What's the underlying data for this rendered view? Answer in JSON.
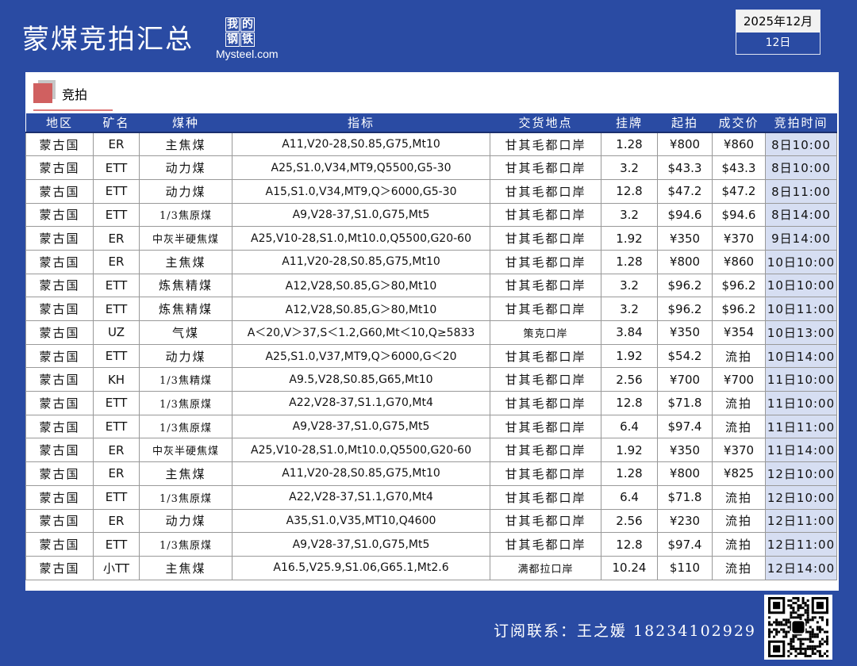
{
  "header": {
    "title": "蒙煤竞拍汇总",
    "logo_text": "我的钢铁 Mysteel.com",
    "logo_cn": [
      "我",
      "的",
      "钢",
      "铁"
    ],
    "logo_en": "Mysteel.com",
    "month": "2025年12月",
    "day": "12日"
  },
  "section": {
    "label": "竞拍"
  },
  "table": {
    "columns": [
      "地区",
      "矿名",
      "煤种",
      "指标",
      "交货地点",
      "挂牌",
      "起拍",
      "成交价",
      "竞拍时间"
    ],
    "rows": [
      [
        "蒙古国",
        "ER",
        "主焦煤",
        "A11,V20-28,S0.85,G75,Mt10",
        "甘其毛都口岸",
        "1.28",
        "¥800",
        "¥860",
        "8日10:00"
      ],
      [
        "蒙古国",
        "ETT",
        "动力煤",
        "A25,S1.0,V34,MT9,Q5500,G5-30",
        "甘其毛都口岸",
        "3.2",
        "$43.3",
        "$43.3",
        "8日10:00"
      ],
      [
        "蒙古国",
        "ETT",
        "动力煤",
        "A15,S1.0,V34,MT9,Q＞6000,G5-30",
        "甘其毛都口岸",
        "12.8",
        "$47.2",
        "$47.2",
        "8日11:00"
      ],
      [
        "蒙古国",
        "ETT",
        "1/3焦原煤",
        "A9,V28-37,S1.0,G75,Mt5",
        "甘其毛都口岸",
        "3.2",
        "$94.6",
        "$94.6",
        "8日14:00"
      ],
      [
        "蒙古国",
        "ER",
        "中灰半硬焦煤",
        "A25,V10-28,S1.0,Mt10.0,Q5500,G20-60",
        "甘其毛都口岸",
        "1.92",
        "¥350",
        "¥370",
        "9日14:00"
      ],
      [
        "蒙古国",
        "ER",
        "主焦煤",
        "A11,V20-28,S0.85,G75,Mt10",
        "甘其毛都口岸",
        "1.28",
        "¥800",
        "¥860",
        "10日10:00"
      ],
      [
        "蒙古国",
        "ETT",
        "炼焦精煤",
        "A12,V28,S0.85,G＞80,Mt10",
        "甘其毛都口岸",
        "3.2",
        "$96.2",
        "$96.2",
        "10日10:00"
      ],
      [
        "蒙古国",
        "ETT",
        "炼焦精煤",
        "A12,V28,S0.85,G＞80,Mt10",
        "甘其毛都口岸",
        "3.2",
        "$96.2",
        "$96.2",
        "10日11:00"
      ],
      [
        "蒙古国",
        "UZ",
        "气煤",
        "A＜20,V＞37,S＜1.2,G60,Mt＜10,Q≥5833",
        "策克口岸",
        "3.84",
        "¥350",
        "¥354",
        "10日13:00"
      ],
      [
        "蒙古国",
        "ETT",
        "动力煤",
        "A25,S1.0,V37,MT9,Q＞6000,G＜20",
        "甘其毛都口岸",
        "1.92",
        "$54.2",
        "流拍",
        "10日14:00"
      ],
      [
        "蒙古国",
        "KH",
        "1/3焦精煤",
        "A9.5,V28,S0.85,G65,Mt10",
        "甘其毛都口岸",
        "2.56",
        "¥700",
        "¥700",
        "11日10:00"
      ],
      [
        "蒙古国",
        "ETT",
        "1/3焦原煤",
        "A22,V28-37,S1.1,G70,Mt4",
        "甘其毛都口岸",
        "12.8",
        "$71.8",
        "流拍",
        "11日10:00"
      ],
      [
        "蒙古国",
        "ETT",
        "1/3焦原煤",
        "A9,V28-37,S1.0,G75,Mt5",
        "甘其毛都口岸",
        "6.4",
        "$97.4",
        "流拍",
        "11日11:00"
      ],
      [
        "蒙古国",
        "ER",
        "中灰半硬焦煤",
        "A25,V10-28,S1.0,Mt10.0,Q5500,G20-60",
        "甘其毛都口岸",
        "1.92",
        "¥350",
        "¥370",
        "11日14:00"
      ],
      [
        "蒙古国",
        "ER",
        "主焦煤",
        "A11,V20-28,S0.85,G75,Mt10",
        "甘其毛都口岸",
        "1.28",
        "¥800",
        "¥825",
        "12日10:00"
      ],
      [
        "蒙古国",
        "ETT",
        "1/3焦原煤",
        "A22,V28-37,S1.1,G70,Mt4",
        "甘其毛都口岸",
        "6.4",
        "$71.8",
        "流拍",
        "12日10:00"
      ],
      [
        "蒙古国",
        "ER",
        "动力煤",
        "A35,S1.0,V35,MT10,Q4600",
        "甘其毛都口岸",
        "2.56",
        "¥230",
        "流拍",
        "12日11:00"
      ],
      [
        "蒙古国",
        "ETT",
        "1/3焦原煤",
        "A9,V28-37,S1.0,G75,Mt5",
        "甘其毛都口岸",
        "12.8",
        "$97.4",
        "流拍",
        "12日11:00"
      ],
      [
        "蒙古国",
        "小TT",
        "主焦煤",
        "A16.5,V25.9,S1.06,G65.1,Mt2.6",
        "满都拉口岸",
        "10.24",
        "$110",
        "流拍",
        "12日14:00"
      ]
    ]
  },
  "footer": {
    "contact": "订阅联系：王之媛  18234102929"
  },
  "colors": {
    "background": "#2a4ba3",
    "time_col": "#d6def2",
    "accent": "#d06060"
  }
}
